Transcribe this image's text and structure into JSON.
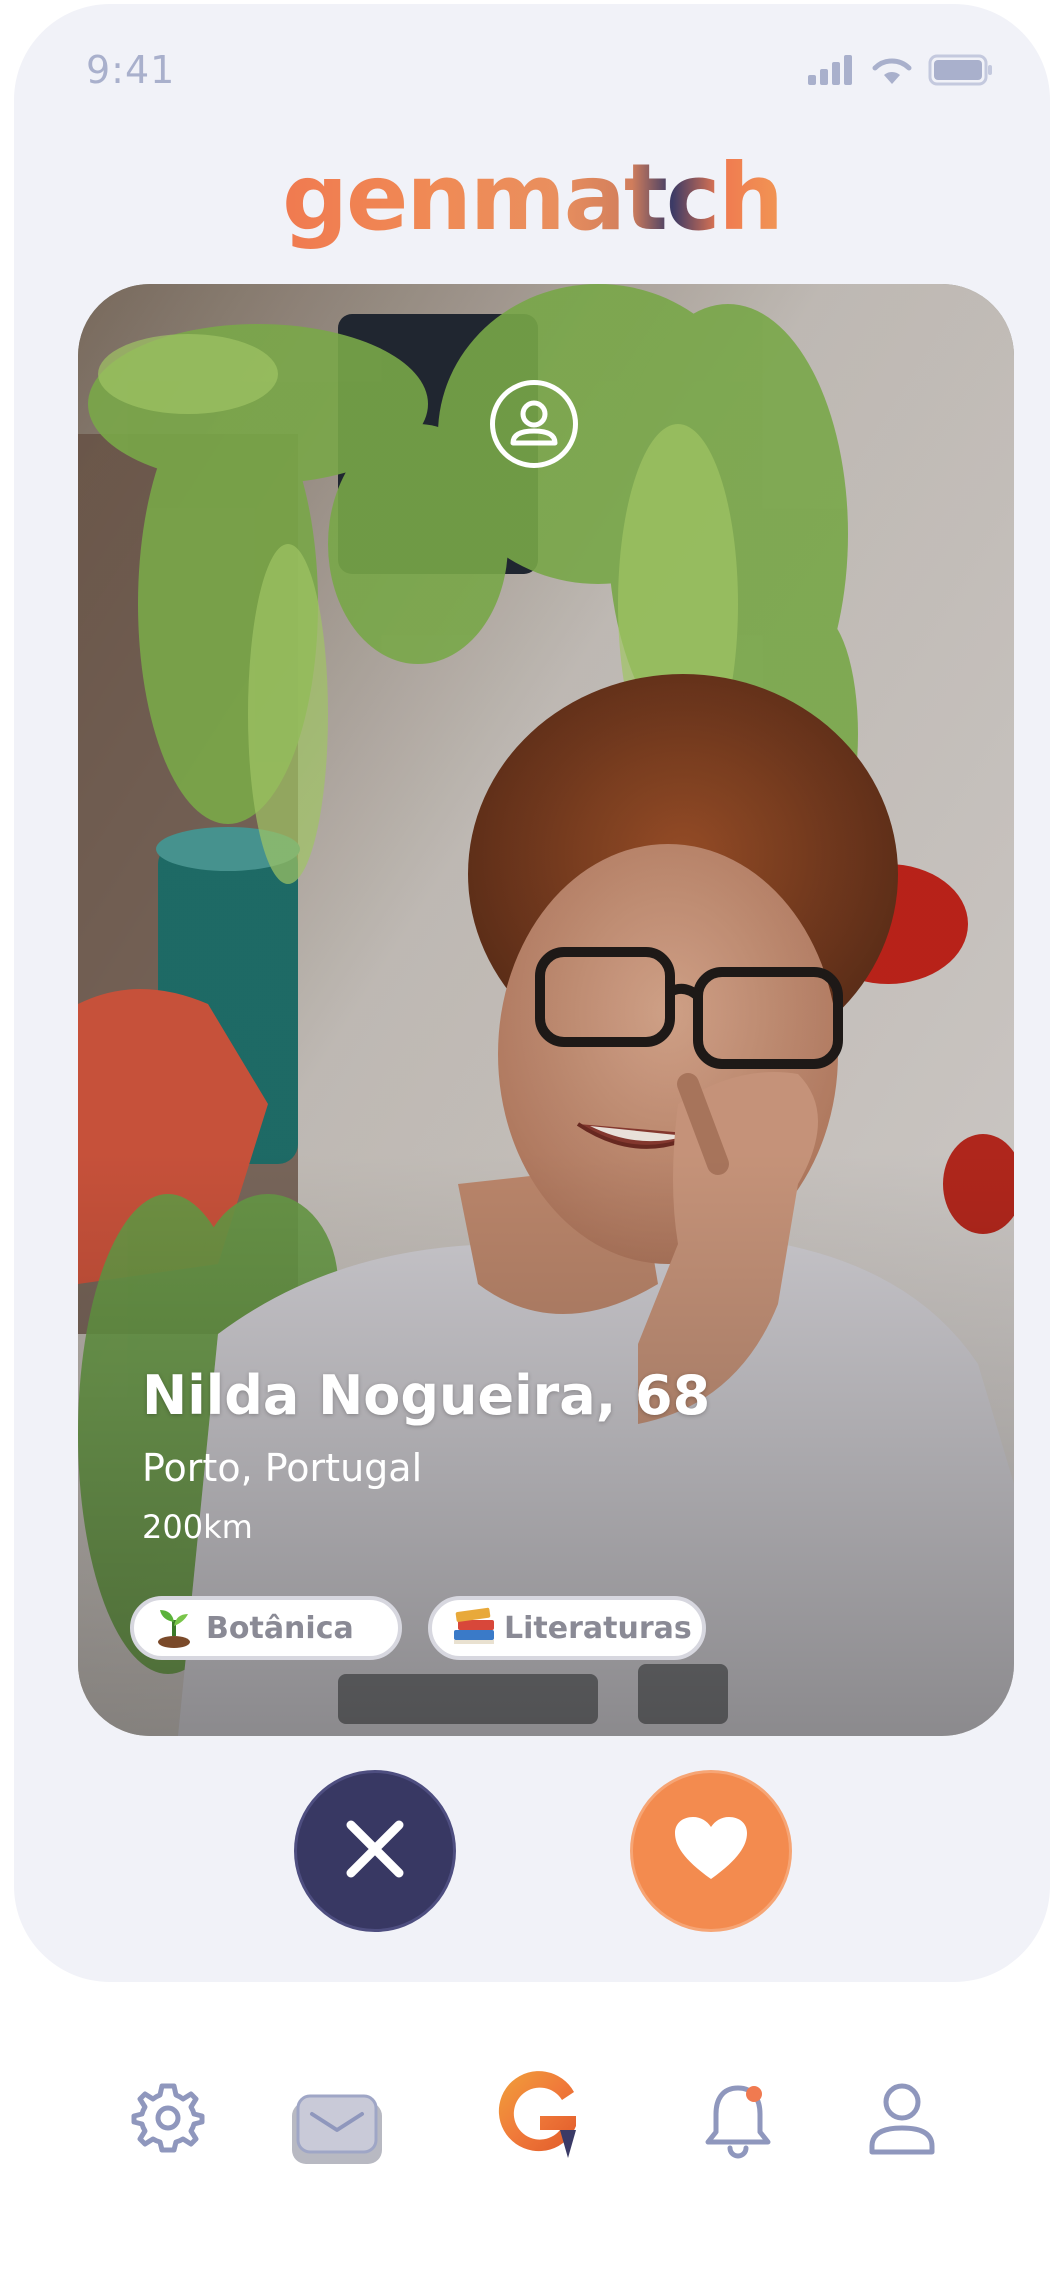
{
  "status_bar": {
    "time": "9:41"
  },
  "app": {
    "logo": "genmatch"
  },
  "profile": {
    "name_age": "Nilda Nogueira, 68",
    "location": "Porto, Portugal",
    "distance": "200km",
    "interests": [
      {
        "label": "Botânica",
        "icon": "seedling-icon"
      },
      {
        "label": "Literaturas",
        "icon": "books-icon"
      }
    ]
  },
  "actions": {
    "dislike_icon": "close-icon",
    "like_icon": "heart-icon"
  },
  "nav": {
    "items": [
      {
        "icon": "gear-icon"
      },
      {
        "icon": "mail-icon"
      },
      {
        "icon": "genmatch-logo-icon"
      },
      {
        "icon": "bell-icon",
        "badge": true
      },
      {
        "icon": "user-icon"
      }
    ]
  },
  "colors": {
    "background": "#f1f2f8",
    "accent_orange": "#f38b4f",
    "navy": "#383863",
    "icon_muted": "#8f97bd",
    "badge": "#f07a50"
  }
}
